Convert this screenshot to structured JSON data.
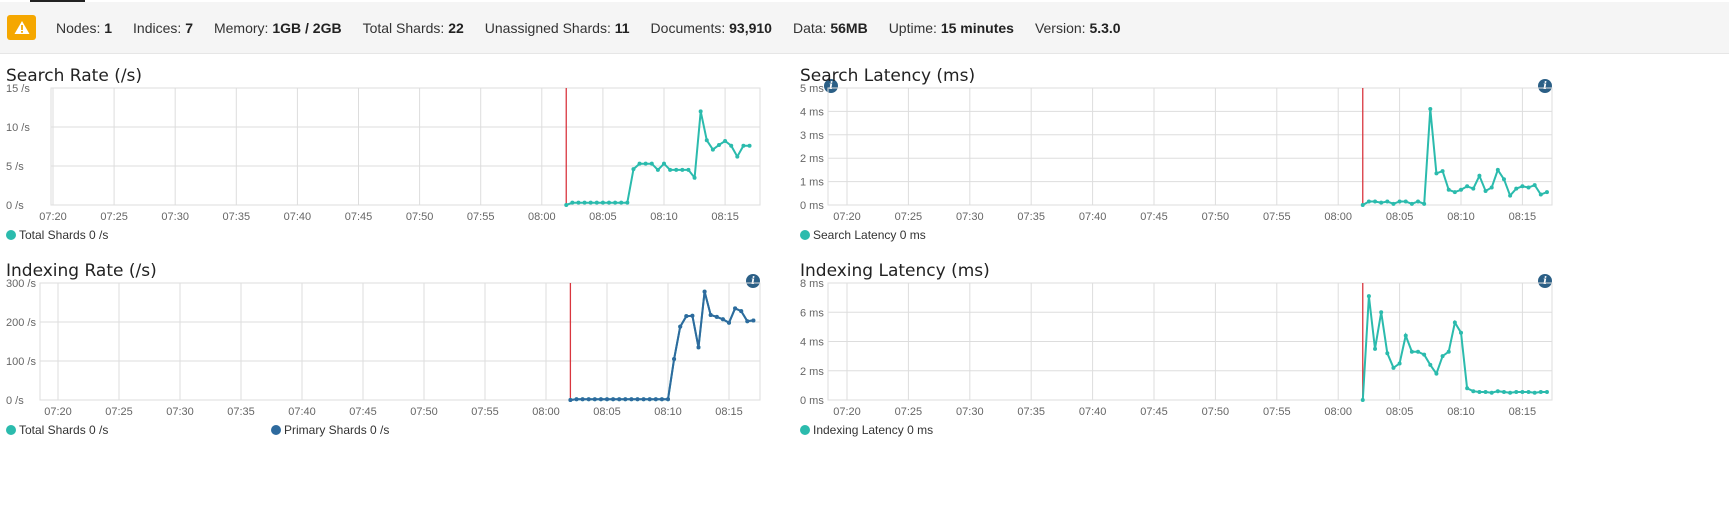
{
  "status": {
    "nodes": {
      "label": "Nodes:",
      "value": "1"
    },
    "indices": {
      "label": "Indices:",
      "value": "7"
    },
    "memory": {
      "label": "Memory:",
      "value": "1GB / 2GB"
    },
    "total_shards": {
      "label": "Total Shards:",
      "value": "22"
    },
    "unassigned": {
      "label": "Unassigned Shards:",
      "value": "11"
    },
    "documents": {
      "label": "Documents:",
      "value": "93,910"
    },
    "data": {
      "label": "Data:",
      "value": "56MB"
    },
    "uptime": {
      "label": "Uptime:",
      "value": "15 minutes"
    },
    "version": {
      "label": "Version:",
      "value": "5.3.0"
    },
    "warning_icon": "warning-triangle-icon",
    "warning_color": "#f5a700"
  },
  "colors": {
    "teal": "#2bbbad",
    "blue": "#2e6a9e",
    "marker": "#d9363e",
    "grid": "#dddddd"
  },
  "chart_data": [
    {
      "id": "search-rate",
      "type": "line",
      "title": "Search Rate (/s)",
      "x_ticks": [
        "07:20",
        "07:25",
        "07:30",
        "07:35",
        "07:40",
        "07:45",
        "07:50",
        "07:55",
        "08:00",
        "08:05",
        "08:10",
        "08:15"
      ],
      "y_ticks": [
        "0 /s",
        "5 /s",
        "10 /s",
        "15 /s"
      ],
      "ylim": [
        0,
        15
      ],
      "marker_x": "08:02",
      "legend": [
        {
          "label": "Total Shards 0 /s",
          "color": "#2bbbad"
        }
      ],
      "series": [
        {
          "name": "Total Shards",
          "color": "#2bbbad",
          "x": [
            "08:02",
            "08:02:30",
            "08:03",
            "08:03:30",
            "08:04",
            "08:04:30",
            "08:05",
            "08:05:30",
            "08:06",
            "08:06:30",
            "08:07",
            "08:07:30",
            "08:08",
            "08:08:30",
            "08:09",
            "08:09:30",
            "08:10",
            "08:10:30",
            "08:11",
            "08:11:30",
            "08:12",
            "08:12:30",
            "08:13",
            "08:13:30",
            "08:14",
            "08:14:30",
            "08:15",
            "08:15:30",
            "08:16",
            "08:16:30",
            "08:17"
          ],
          "y": [
            0,
            0.3,
            0.3,
            0.3,
            0.3,
            0.3,
            0.3,
            0.3,
            0.3,
            0.3,
            0.3,
            4.6,
            5.3,
            5.3,
            5.3,
            4.5,
            5.3,
            4.5,
            4.5,
            4.5,
            4.5,
            3.5,
            12,
            8.3,
            7.1,
            7.7,
            8.2,
            7.6,
            6.2,
            7.6,
            7.6
          ]
        }
      ]
    },
    {
      "id": "search-latency",
      "type": "line",
      "title": "Search Latency (ms)",
      "x_ticks": [
        "07:20",
        "07:25",
        "07:30",
        "07:35",
        "07:40",
        "07:45",
        "07:50",
        "07:55",
        "08:00",
        "08:05",
        "08:10",
        "08:15"
      ],
      "y_ticks": [
        "0 ms",
        "1 ms",
        "2 ms",
        "3 ms",
        "4 ms",
        "5 ms"
      ],
      "ylim": [
        0,
        5
      ],
      "marker_x": "08:02",
      "legend": [
        {
          "label": "Search Latency 0 ms",
          "color": "#2bbbad"
        }
      ],
      "series": [
        {
          "name": "Search Latency",
          "color": "#2bbbad",
          "x": [
            "08:02",
            "08:02:30",
            "08:03",
            "08:03:30",
            "08:04",
            "08:04:30",
            "08:05",
            "08:05:30",
            "08:06",
            "08:06:30",
            "08:07",
            "08:07:30",
            "08:08",
            "08:08:30",
            "08:09",
            "08:09:30",
            "08:10",
            "08:10:30",
            "08:11",
            "08:11:30",
            "08:12",
            "08:12:30",
            "08:13",
            "08:13:30",
            "08:14",
            "08:14:30",
            "08:15",
            "08:15:30",
            "08:16",
            "08:16:30",
            "08:17"
          ],
          "y": [
            0,
            0.15,
            0.15,
            0.1,
            0.15,
            0.05,
            0.15,
            0.15,
            0.05,
            0.15,
            0.05,
            4.1,
            1.35,
            1.45,
            0.65,
            0.55,
            0.65,
            0.8,
            0.7,
            1.25,
            0.6,
            0.75,
            1.5,
            1.1,
            0.4,
            0.7,
            0.8,
            0.75,
            0.85,
            0.45,
            0.55
          ]
        }
      ]
    },
    {
      "id": "indexing-rate",
      "type": "line",
      "title": "Indexing Rate (/s)",
      "x_ticks": [
        "07:20",
        "07:25",
        "07:30",
        "07:35",
        "07:40",
        "07:45",
        "07:50",
        "07:55",
        "08:00",
        "08:05",
        "08:10",
        "08:15"
      ],
      "y_ticks": [
        "0 /s",
        "100 /s",
        "200 /s",
        "300 /s"
      ],
      "ylim": [
        0,
        300
      ],
      "marker_x": "08:02",
      "legend": [
        {
          "label": "Total Shards 0 /s",
          "color": "#2bbbad"
        },
        {
          "label": "Primary Shards 0 /s",
          "color": "#2e6a9e"
        }
      ],
      "series": [
        {
          "name": "Total Shards",
          "color": "#2bbbad",
          "x": [
            "08:02",
            "08:02:30",
            "08:03",
            "08:03:30",
            "08:04",
            "08:04:30",
            "08:05",
            "08:05:30",
            "08:06",
            "08:06:30",
            "08:07",
            "08:07:30",
            "08:08",
            "08:08:30",
            "08:09",
            "08:09:30",
            "08:10",
            "08:10:30",
            "08:11",
            "08:11:30",
            "08:12",
            "08:12:30",
            "08:13",
            "08:13:30",
            "08:14",
            "08:14:30",
            "08:15",
            "08:15:30",
            "08:16",
            "08:16:30",
            "08:17"
          ],
          "y": [
            0,
            2,
            2,
            2,
            2,
            2,
            2,
            2,
            2,
            2,
            2,
            2,
            2,
            2,
            2,
            2,
            2,
            105,
            188,
            215,
            216,
            135,
            278,
            218,
            213,
            207,
            198,
            235,
            228,
            202,
            204
          ]
        },
        {
          "name": "Primary Shards",
          "color": "#2e6a9e",
          "x": [
            "08:02",
            "08:02:30",
            "08:03",
            "08:03:30",
            "08:04",
            "08:04:30",
            "08:05",
            "08:05:30",
            "08:06",
            "08:06:30",
            "08:07",
            "08:07:30",
            "08:08",
            "08:08:30",
            "08:09",
            "08:09:30",
            "08:10",
            "08:10:30",
            "08:11",
            "08:11:30",
            "08:12",
            "08:12:30",
            "08:13",
            "08:13:30",
            "08:14",
            "08:14:30",
            "08:15",
            "08:15:30",
            "08:16",
            "08:16:30",
            "08:17"
          ],
          "y": [
            0,
            2,
            2,
            2,
            2,
            2,
            2,
            2,
            2,
            2,
            2,
            2,
            2,
            2,
            2,
            2,
            2,
            105,
            188,
            215,
            216,
            135,
            278,
            218,
            213,
            207,
            198,
            235,
            228,
            202,
            204
          ]
        }
      ]
    },
    {
      "id": "indexing-latency",
      "type": "line",
      "title": "Indexing Latency (ms)",
      "x_ticks": [
        "07:20",
        "07:25",
        "07:30",
        "07:35",
        "07:40",
        "07:45",
        "07:50",
        "07:55",
        "08:00",
        "08:05",
        "08:10",
        "08:15"
      ],
      "y_ticks": [
        "0 ms",
        "2 ms",
        "4 ms",
        "6 ms",
        "8 ms"
      ],
      "ylim": [
        0,
        8
      ],
      "marker_x": "08:02",
      "legend": [
        {
          "label": "Indexing Latency 0 ms",
          "color": "#2bbbad"
        }
      ],
      "series": [
        {
          "name": "Indexing Latency",
          "color": "#2bbbad",
          "x": [
            "08:02",
            "08:02:30",
            "08:03",
            "08:03:30",
            "08:04",
            "08:04:30",
            "08:05",
            "08:05:30",
            "08:06",
            "08:06:30",
            "08:07",
            "08:07:30",
            "08:08",
            "08:08:30",
            "08:09",
            "08:09:30",
            "08:10",
            "08:10:30",
            "08:11",
            "08:11:30",
            "08:12",
            "08:12:30",
            "08:13",
            "08:13:30",
            "08:14",
            "08:14:30",
            "08:15",
            "08:15:30",
            "08:16",
            "08:16:30",
            "08:17"
          ],
          "y": [
            0,
            7.1,
            3.5,
            6.0,
            3.2,
            2.2,
            2.5,
            4.4,
            3.3,
            3.3,
            3.1,
            2.4,
            1.8,
            3.0,
            3.3,
            5.3,
            4.6,
            0.8,
            0.6,
            0.55,
            0.55,
            0.5,
            0.6,
            0.55,
            0.5,
            0.55,
            0.55,
            0.55,
            0.5,
            0.55,
            0.55
          ]
        }
      ]
    }
  ]
}
